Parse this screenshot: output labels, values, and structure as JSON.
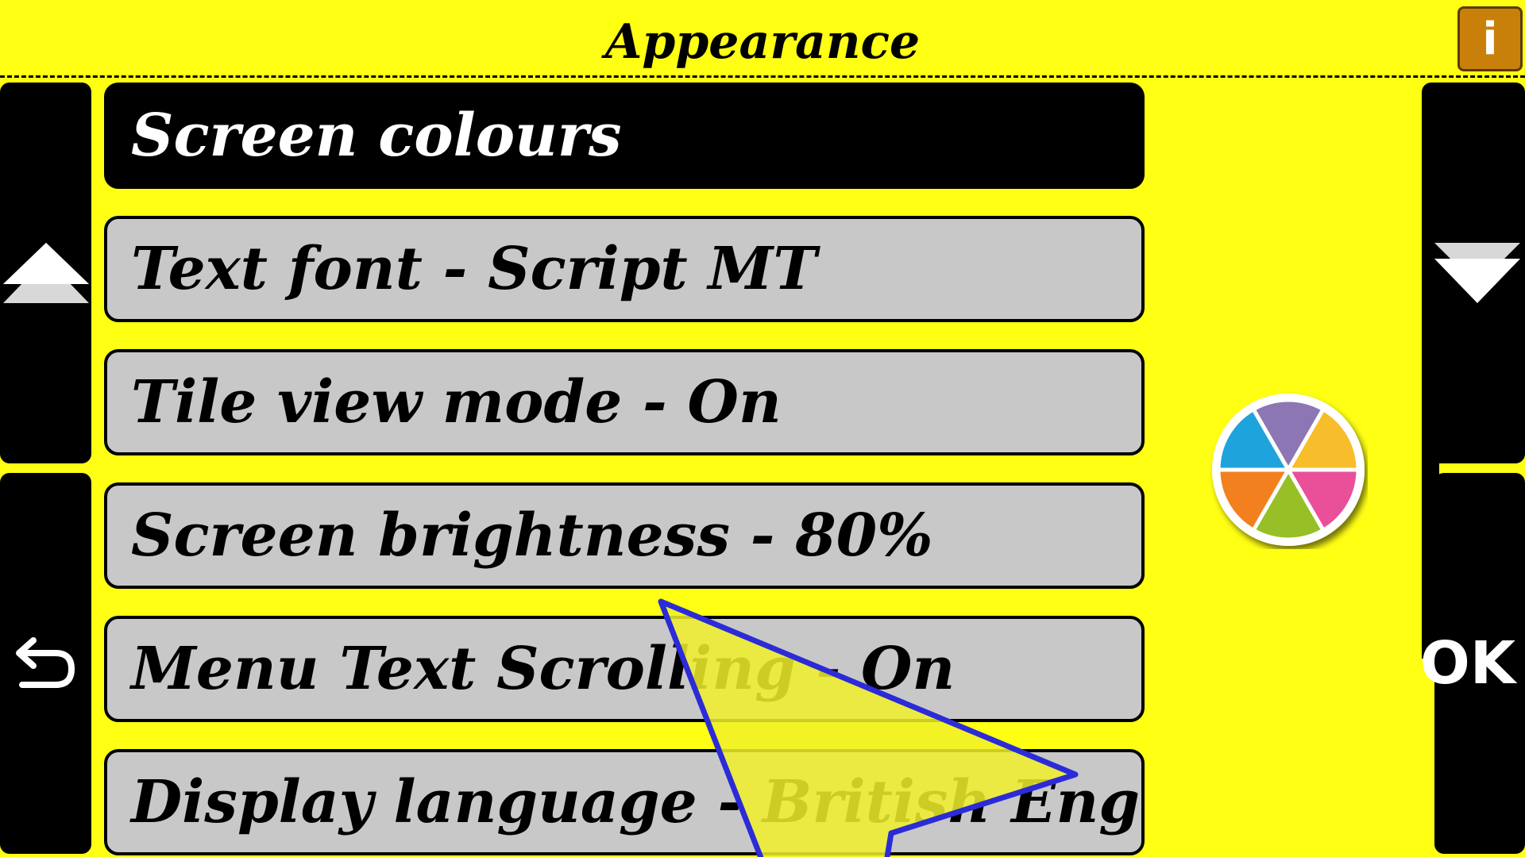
{
  "header": {
    "title": "Appearance",
    "info_label": "i"
  },
  "nav": {
    "up_icon": "double-chevron-up-icon",
    "back_icon": "back-arrow-icon",
    "down_icon": "double-chevron-down-icon",
    "ok_label": "OK"
  },
  "menu": {
    "items": [
      {
        "label": "Screen colours",
        "selected": true
      },
      {
        "label": "Text font - Script MT",
        "selected": false
      },
      {
        "label": "Tile view mode - On",
        "selected": false
      },
      {
        "label": "Screen brightness - 80%",
        "selected": false
      },
      {
        "label": "Menu Text Scrolling - On",
        "selected": false
      },
      {
        "label": "Display language - British English",
        "selected": false
      }
    ]
  },
  "colour_wheel": {
    "segments": [
      "#8d76b4",
      "#f7bd2a",
      "#ea4f9a",
      "#97bf26",
      "#f3801f",
      "#1fa3dc"
    ]
  },
  "colors": {
    "background": "#ffff14",
    "rail": "#000000",
    "item": "#c8c8c8",
    "selected_item": "#000000",
    "info_button": "#c9800b",
    "cursor_fill": "#f0f02a",
    "cursor_border": "#2b2bd8"
  }
}
